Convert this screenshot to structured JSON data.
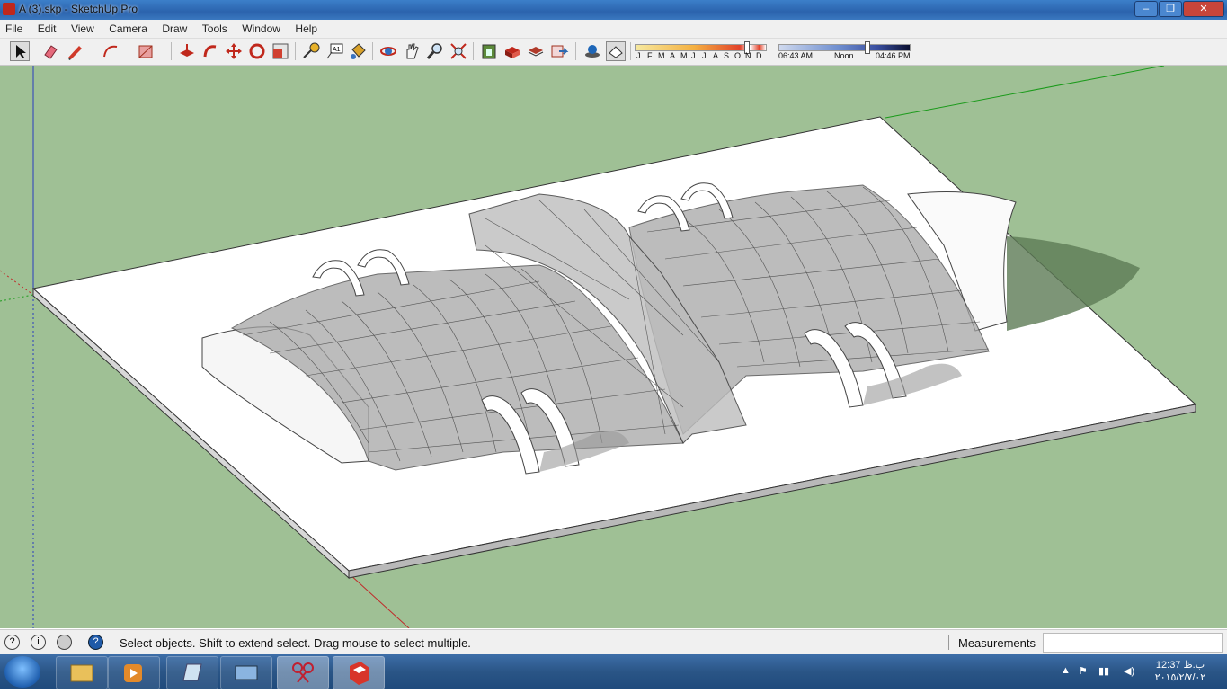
{
  "window": {
    "title": "A (3).skp - SketchUp Pro",
    "minimize": "–",
    "maximize": "❐",
    "close": "✕"
  },
  "menu": [
    "File",
    "Edit",
    "View",
    "Camera",
    "Draw",
    "Tools",
    "Window",
    "Help"
  ],
  "toolbar": {
    "shadow_months": [
      "J",
      "F",
      "M",
      "A",
      "M",
      "J",
      "J",
      "A",
      "S",
      "O",
      "N",
      "D"
    ],
    "sunrise": "06:43 AM",
    "noon": "Noon",
    "sunset": "04:46 PM",
    "icons": [
      "select-icon",
      "eraser-icon",
      "pencil-icon",
      "arc-icon",
      "rectangle-icon",
      "push-pull-icon",
      "follow-me-icon",
      "move-icon",
      "rotate-icon",
      "scale-icon",
      "tape-measure-icon",
      "text-icon",
      "paint-bucket-icon",
      "orbit-icon",
      "pan-icon",
      "zoom-icon",
      "zoom-extents-icon",
      "3d-warehouse-icon",
      "component-icon",
      "share-model-icon",
      "send-to-layout-icon",
      "shadows-icon",
      "fog-icon"
    ]
  },
  "status": {
    "hint": "Select objects. Shift to extend select. Drag mouse to select multiple.",
    "measurements_label": "Measurements",
    "measurements_value": ""
  },
  "taskbar": {
    "time": "12:37 ب.ظ",
    "date": "٢٠١٥/٢/٧/٠٢",
    "apps": [
      "explorer-icon",
      "media-player-icon",
      "notepad-icon",
      "network-icon",
      "snipping-tool-icon",
      "sketchup-icon"
    ]
  },
  "colors": {
    "viewport_bg": "#9fc095",
    "ground": "#ffffff",
    "title_bar": "#2b63ad"
  }
}
